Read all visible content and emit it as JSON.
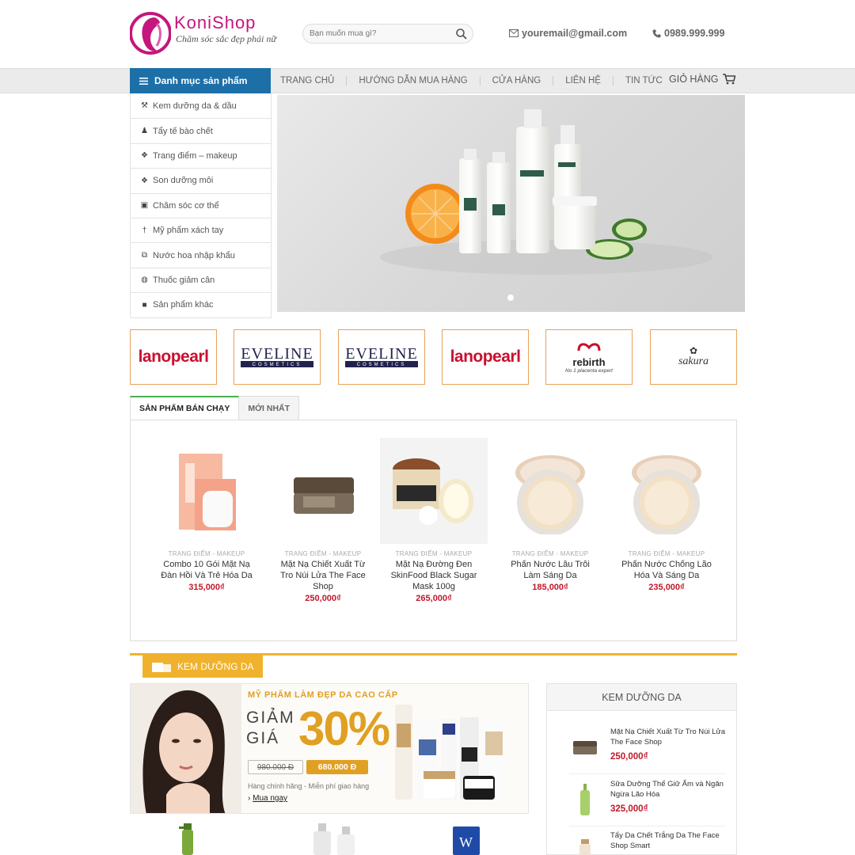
{
  "header": {
    "brand_name": "KoniShop",
    "tagline": "Chăm sóc sắc đẹp phái nữ",
    "search_placeholder": "Bạn muốn mua gì?",
    "email": "youremail@gmail.com",
    "phone": "0989.999.999"
  },
  "nav": {
    "category_label": "Danh mục sản phẩm",
    "items": [
      "Trang chủ",
      "Hướng dẫn mua hàng",
      "Cửa hàng",
      "Liên hệ",
      "Tin tức"
    ],
    "cart_label": "GIỎ HÀNG"
  },
  "categories": [
    {
      "label": "Kem dưỡng da & dầu",
      "icon": "wrench-icon"
    },
    {
      "label": "Tẩy tế bào chết",
      "icon": "users-icon"
    },
    {
      "label": "Trang điểm – makeup",
      "icon": "cubes-icon"
    },
    {
      "label": "Son dưỡng môi",
      "icon": "cubes-icon"
    },
    {
      "label": "Chăm sóc cơ thể",
      "icon": "gift-icon"
    },
    {
      "label": "Mỹ phẩm xách tay",
      "icon": "pin-icon"
    },
    {
      "label": "Nước hoa nhập khẩu",
      "icon": "clone-icon"
    },
    {
      "label": "Thuốc giảm cân",
      "icon": "globe-icon"
    },
    {
      "label": "Sản phẩm khác",
      "icon": "bag-icon"
    }
  ],
  "brands": [
    {
      "name": "lanopearl",
      "style": "lano"
    },
    {
      "name": "EVELINE",
      "sub": "COSMETICS",
      "style": "eve"
    },
    {
      "name": "EVELINE",
      "sub": "COSMETICS",
      "style": "eve"
    },
    {
      "name": "lanopearl",
      "style": "lano"
    },
    {
      "name": "rebirth",
      "sub": "No 1 placenta expert",
      "style": "reb"
    },
    {
      "name": "sakura",
      "style": "sak"
    }
  ],
  "tabs": [
    "Sản phẩm bán chạy",
    "Mới nhất"
  ],
  "products": [
    {
      "category": "Trang điểm - makeup",
      "name": "Combo 10 Gói Mặt Nạ Đàn Hồi Và Trẻ Hóa Da",
      "price": "315,000₫",
      "img": "mask"
    },
    {
      "category": "Trang điểm - makeup",
      "name": "Mặt Nạ Chiết Xuất Từ Tro Núi Lửa The Face Shop",
      "price": "250,000₫",
      "img": "jar"
    },
    {
      "category": "Trang điểm - makeup",
      "name": "Mặt Nạ Đường Đen SkinFood Black Sugar Mask 100g",
      "price": "265,000₫",
      "img": "sugar"
    },
    {
      "category": "Trang điểm - makeup",
      "name": "Phấn Nước Lâu Trôi Làm Sáng Da",
      "price": "185,000₫",
      "img": "cushion"
    },
    {
      "category": "Trang điểm - makeup",
      "name": "Phấn Nước Chống Lão Hóa Và Sáng Da",
      "price": "235,000₫",
      "img": "cushion"
    }
  ],
  "section": {
    "title": "Kem dưỡng da"
  },
  "promo": {
    "headline": "MỸ PHẨM LÀM ĐẸP DA CAO CẤP",
    "discount_word": "GIẢM GIÁ",
    "percent": "30%",
    "old_price": "980.000 Đ",
    "new_price": "680.000 Đ",
    "note": "Hàng chính hãng - Miễn phí giao hàng",
    "cta": "Mua ngay"
  },
  "widget": {
    "title": "Kem dưỡng da",
    "items": [
      {
        "name": "Mặt Nạ Chiết Xuất Từ Tro Núi Lửa The Face Shop",
        "price": "250,000₫"
      },
      {
        "name": "Sữa Dưỡng Thể Giữ Ẩm và Ngăn Ngừa Lão Hóa",
        "price": "325,000₫"
      },
      {
        "name": "Tẩy Da Chết Trắng Da The Face Shop Smart",
        "price": ""
      }
    ]
  },
  "colors": {
    "brand": "#c4167c",
    "nav_category_bg": "#1d6fa8",
    "accent_orange": "#f0b22c",
    "price_red": "#c0192a",
    "tab_active_border": "#4caf50"
  }
}
